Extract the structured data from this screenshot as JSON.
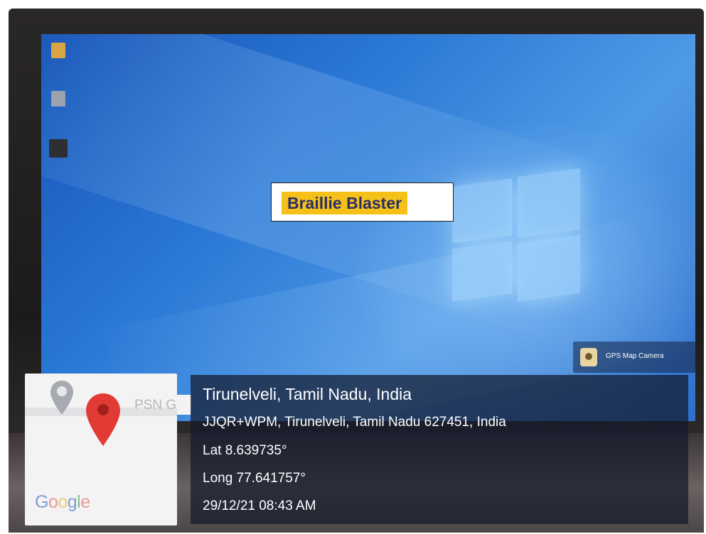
{
  "screen": {
    "desktop_icons": [
      {
        "name": "folder-icon",
        "label": "",
        "color": "#d9a544"
      },
      {
        "name": "recycle-bin-icon",
        "label": "",
        "color": "#9aa3ad"
      },
      {
        "name": "app-shortcut-icon",
        "label": "",
        "color": "#2d2f33"
      }
    ],
    "app_title": "Braillie Blaster",
    "title_highlight_color": "#f5c018",
    "title_text_color": "#2a2e6a",
    "watermark_badge": "GPS Map Camera"
  },
  "map": {
    "place_label": "PSN G",
    "provider": "Google",
    "pin_color": "#e23b36"
  },
  "location": {
    "title": "Tirunelveli, Tamil Nadu, India",
    "address": "JJQR+WPM, Tirunelveli, Tamil Nadu 627451, India",
    "latitude": "Lat 8.639735°",
    "longitude": "Long 77.641757°",
    "datetime": "29/12/21 08:43 AM"
  }
}
